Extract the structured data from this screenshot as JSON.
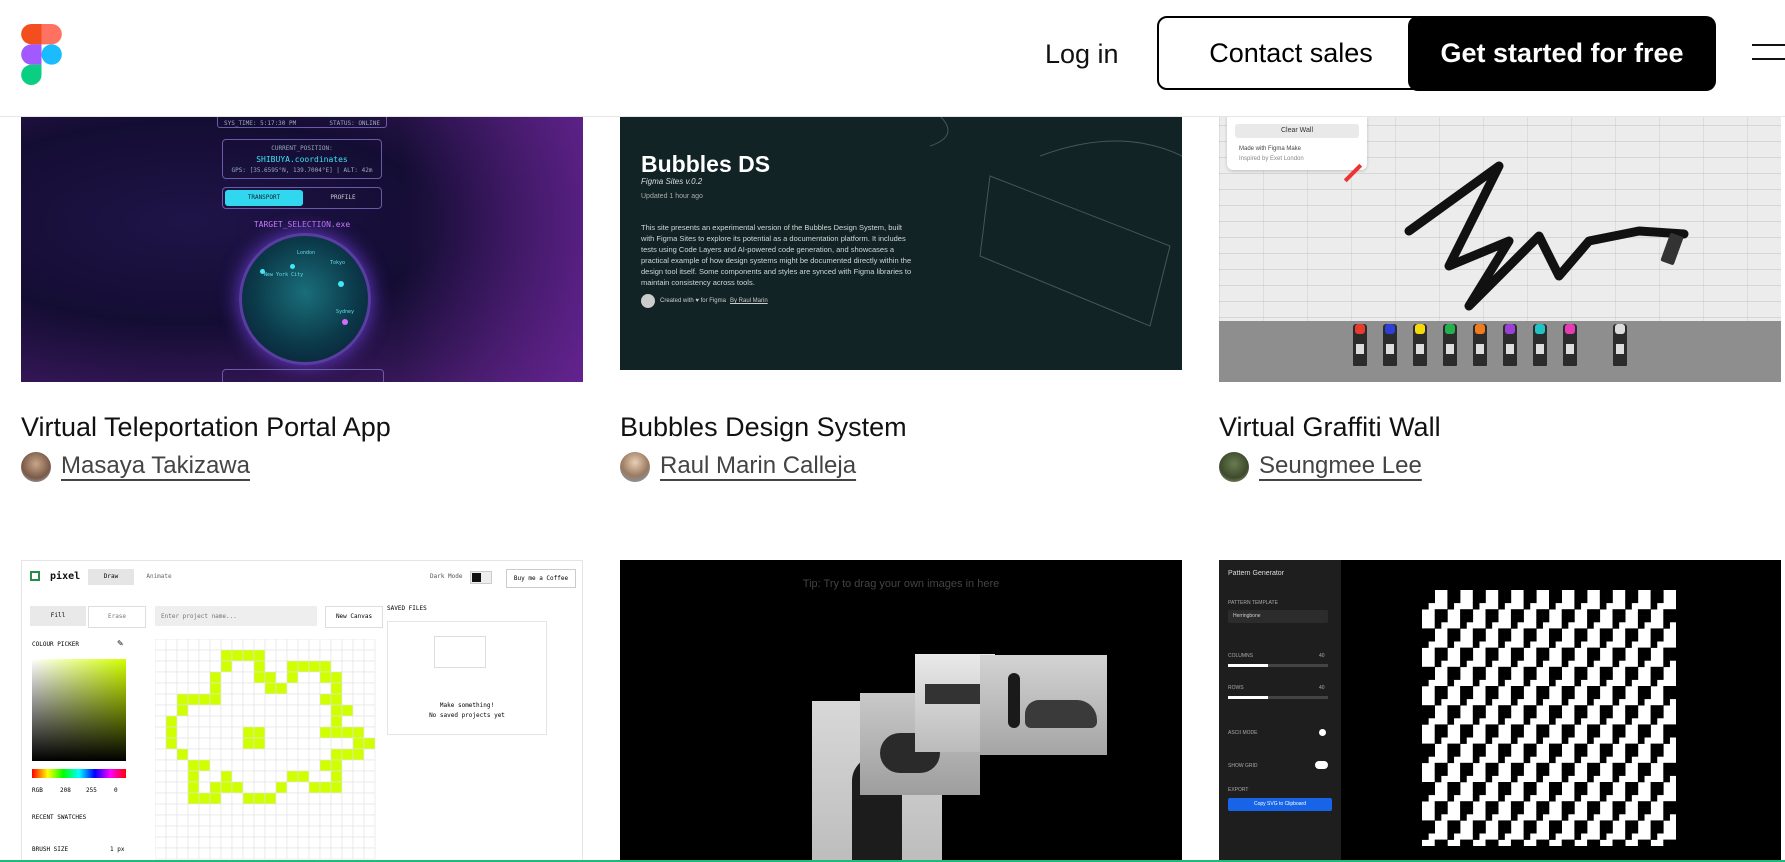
{
  "header": {
    "login_label": "Log in",
    "contact_label": "Contact sales",
    "cta_label": "Get started for free"
  },
  "cards": [
    {
      "title": "Virtual Teleportation Portal App",
      "author": "Masaya Takizawa",
      "preview": {
        "sys_time": "SYS_TIME: 5:17:30 PM",
        "status": "STATUS: ONLINE",
        "current_position": "CURRENT_POSITION:",
        "coords_label": "SHIBUYA.coordinates",
        "coords": "GPS: [35.6595°N, 139.7004°E] | ALT: 42m",
        "transport": "TRANSPORT",
        "profile": "PROFILE",
        "target": "TARGET_SELECTION.exe",
        "city_1": "London",
        "city_2": "Tokyo",
        "city_3": "New York City",
        "city_4": "Sydney"
      }
    },
    {
      "title": "Bubbles Design System",
      "author": "Raul Marin Calleja",
      "preview": {
        "heading": "Bubbles DS",
        "subheading": "Figma Sites v.0.2",
        "updated": "Updated 1 hour ago",
        "body": "This site presents an experimental version of the Bubbles Design System, built with Figma Sites to explore its potential as a documentation platform. It includes tests using Code Layers and AI-powered code generation, and showcases a practical example of how design systems might be documented directly within the design tool itself. Some components and styles are synced with Figma libraries to maintain consistency across tools.",
        "created": "Created with ♥ for Figma",
        "by": "By Raul Marin"
      }
    },
    {
      "title": "Virtual Graffiti Wall",
      "author": "Seungmee Lee",
      "preview": {
        "clear": "Clear Wall",
        "made": "Made with Figma Make",
        "inspired": "Inspired by Exet London",
        "spray_colors": [
          "#e63b2e",
          "#2d3fd6",
          "#f5d90a",
          "#22b14c",
          "#f07b1a",
          "#9b3fd6",
          "#20c4c4",
          "#e63bb5",
          "#dddddd"
        ]
      }
    },
    {
      "preview": {
        "app": "pixel",
        "draw": "Draw",
        "animate": "Animate",
        "dark_mode": "Dark Mode",
        "coffee": "Buy me a Coffee",
        "fill": "Fill",
        "erase": "Erase",
        "project_placeholder": "Enter project name...",
        "new_canvas": "New Canvas",
        "saved_files": "SAVED FILES",
        "colour_picker": "COLOUR PICKER",
        "rgb": "RGB",
        "r": "208",
        "g": "255",
        "b": "0",
        "recent": "RECENT SWATCHES",
        "brush": "BRUSH SIZE",
        "brush_val": "1 px",
        "make": "Make something!",
        "no_saved": "No saved projects yet",
        "pixel_color": "#d0ff00"
      }
    },
    {
      "preview": {
        "tip": "Tip: Try to drag your own images in here"
      }
    },
    {
      "preview": {
        "title": "Pattern Generator",
        "template_label": "PATTERN TEMPLATE",
        "template_value": "Herringbone",
        "columns": "COLUMNS",
        "columns_val": "40",
        "rows": "ROWS",
        "rows_val": "40",
        "ascii": "ASCII MODE",
        "grid": "SHOW GRID",
        "export": "EXPORT",
        "copy": "Copy SVG to Clipboard"
      }
    }
  ]
}
